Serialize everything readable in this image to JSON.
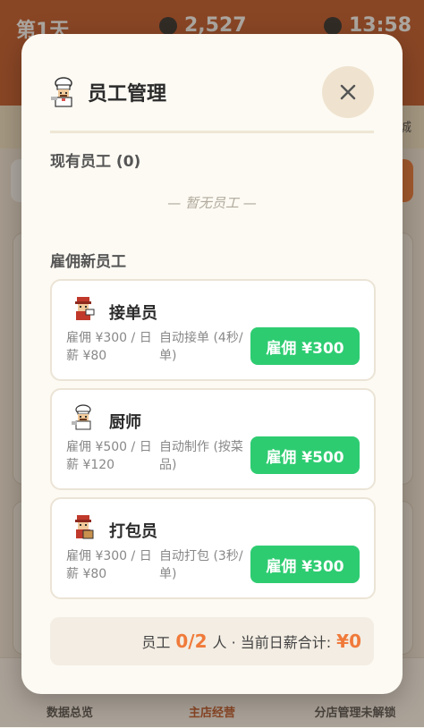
{
  "background": {
    "day_label": "第1天",
    "money": "2,527",
    "time": "13:58",
    "subbar_tag": "城",
    "nav": [
      {
        "label": "数据总览"
      },
      {
        "label": "主店经营"
      },
      {
        "label": "分店管理未解锁"
      }
    ]
  },
  "modal": {
    "title": "员工管理",
    "current_staff_label": "现有员工 (0)",
    "empty_text": "— 暂无员工 —",
    "hire_section_label": "雇佣新员工",
    "candidates": [
      {
        "name": "接单员",
        "cost": "雇佣 ¥300 / 日薪 ¥80",
        "duty": "自动接单 (4秒/单)",
        "button": "雇佣 ¥300",
        "avatar_icon": "waiter-avatar-icon"
      },
      {
        "name": "厨师",
        "cost": "雇佣 ¥500 / 日薪 ¥120",
        "duty": "自动制作 (按菜品)",
        "button": "雇佣 ¥500",
        "avatar_icon": "chef-avatar-icon"
      },
      {
        "name": "打包员",
        "cost": "雇佣 ¥300 / 日薪 ¥80",
        "duty": "自动打包 (3秒/单)",
        "button": "雇佣 ¥300",
        "avatar_icon": "packer-avatar-icon"
      }
    ],
    "footer": {
      "prefix": "员工",
      "count": "0/2",
      "middle": "人 · 当前日薪合计:",
      "total": "¥0"
    }
  },
  "colors": {
    "accent_orange": "#f07a3a",
    "hire_green": "#2ecc71",
    "brand_brown": "#c2582a"
  }
}
